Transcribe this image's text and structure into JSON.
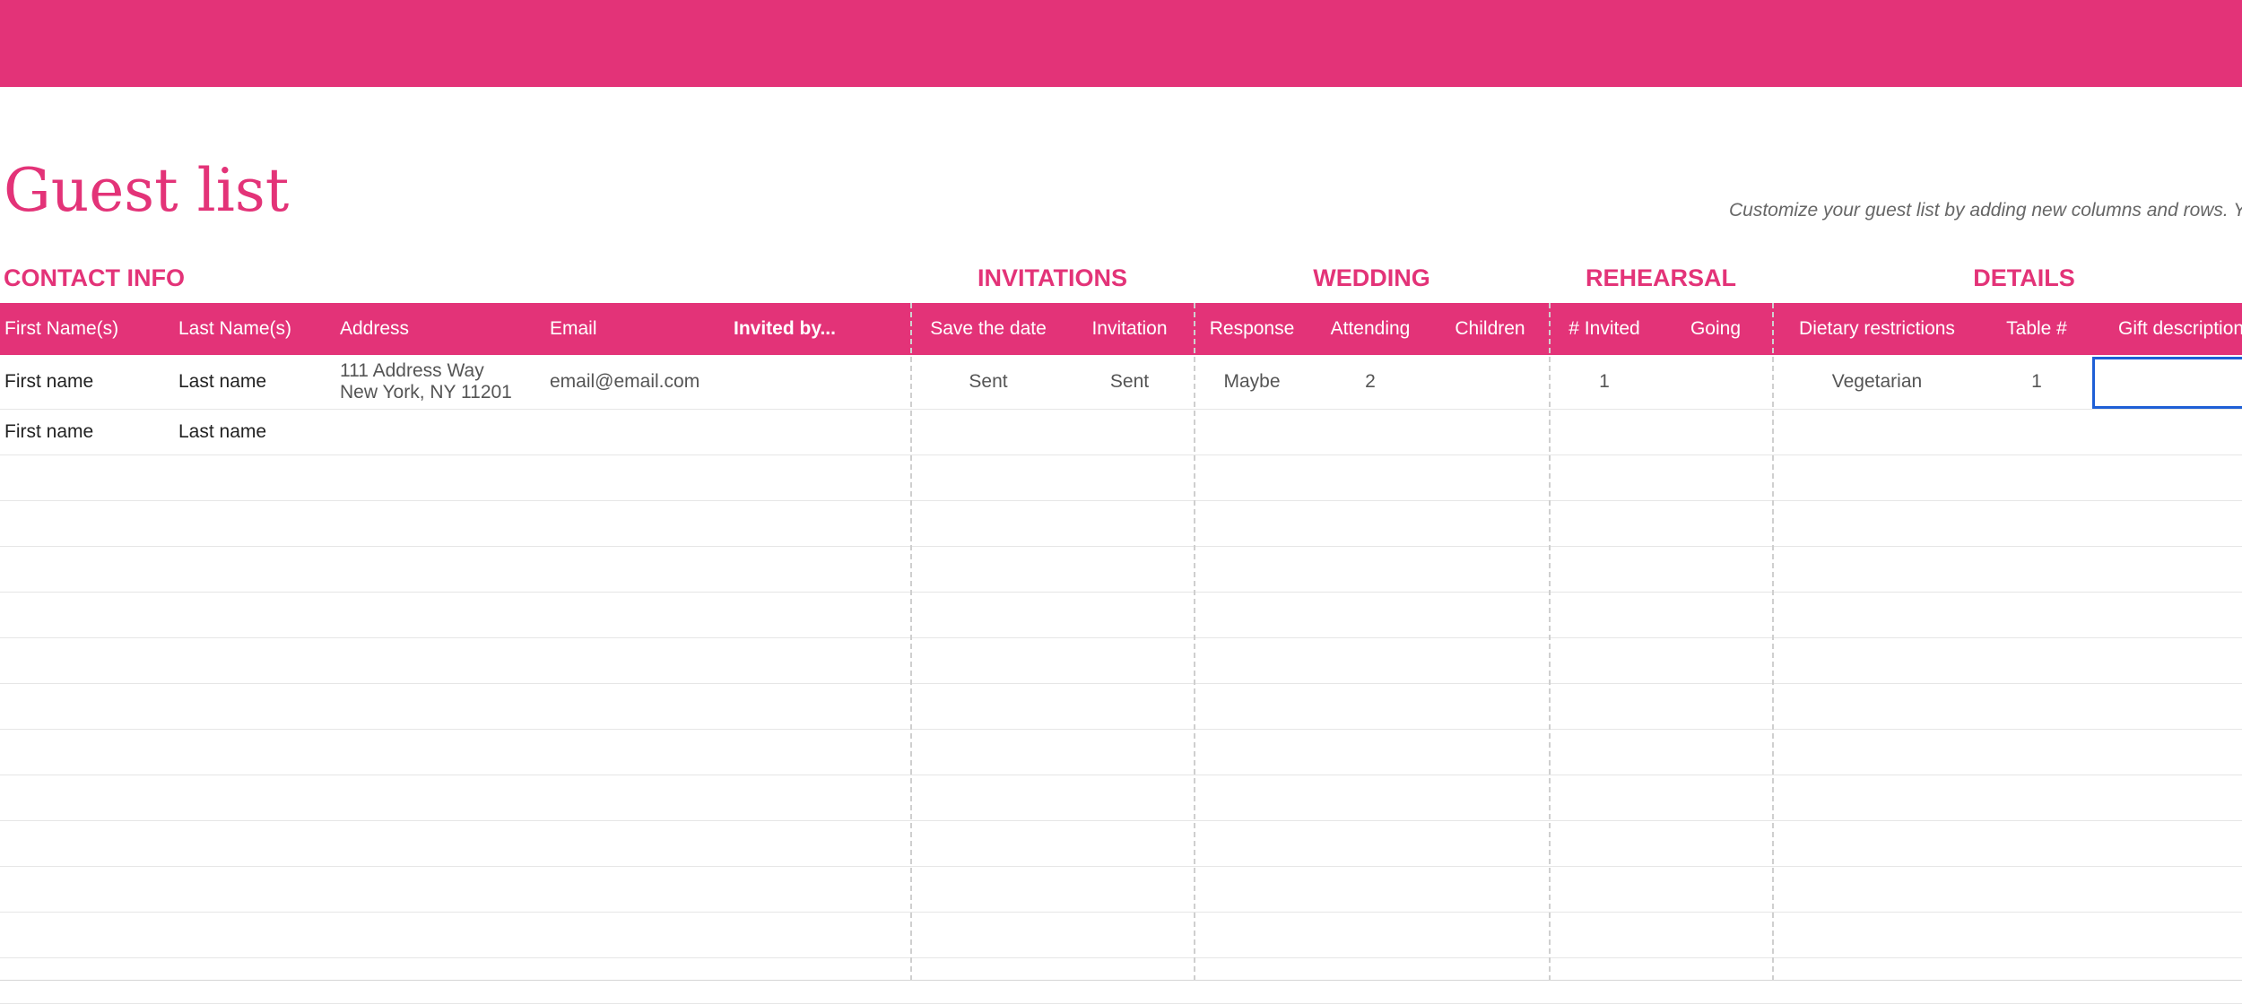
{
  "page": {
    "title": "Guest list",
    "hint": "Customize your guest list by adding new columns and rows. Y"
  },
  "sections": {
    "contact_info": "CONTACT INFO",
    "invitations": "INVITATIONS",
    "wedding": "WEDDING",
    "rehearsal": "REHEARSAL",
    "details": "DETAILS"
  },
  "columns": {
    "first_name": "First Name(s)",
    "last_name": "Last Name(s)",
    "address": "Address",
    "email": "Email",
    "invited_by": "Invited by...",
    "save_the_date": "Save the date",
    "invitation": "Invitation",
    "response": "Response",
    "attending": "Attending",
    "children": "Children",
    "invited_count": "# Invited",
    "going": "Going",
    "dietary": "Dietary restrictions",
    "table": "Table #",
    "gift": "Gift description"
  },
  "rows": [
    {
      "first_name": "First name",
      "last_name": "Last name",
      "address_line1": "111 Address Way",
      "address_line2": "New York, NY 11201",
      "email": "email@email.com",
      "invited_by": "",
      "save_the_date": "Sent",
      "invitation": "Sent",
      "response": "Maybe",
      "attending": "2",
      "children": "",
      "invited_count": "1",
      "going": "",
      "dietary": "Vegetarian",
      "table": "1",
      "gift": ""
    },
    {
      "first_name": "First name",
      "last_name": "Last name"
    }
  ],
  "colors": {
    "accent": "#e33378",
    "selection": "#1f5fd6",
    "hint_text": "#666666"
  }
}
